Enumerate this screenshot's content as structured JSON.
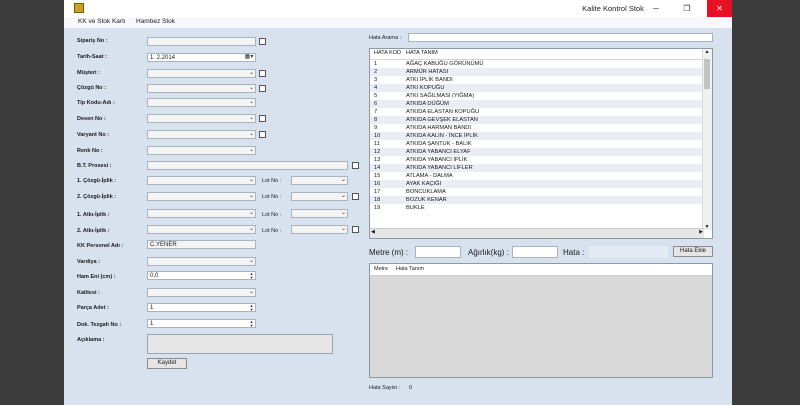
{
  "window": {
    "title": "Kalite Kontrol Stok",
    "minimize": "─",
    "maximize": "❐",
    "close": "✕"
  },
  "menu": [
    "KK ve Stok Kartı",
    "Hambez Stok"
  ],
  "form": {
    "siparis_no": {
      "label": "Sipariş No :",
      "value": ""
    },
    "tarih_saat": {
      "label": "Tarih-Saat :",
      "value": "1.  2.2014"
    },
    "musteri": {
      "label": "Müşteri :"
    },
    "cozgu": {
      "label": "Çözgü No :"
    },
    "tip_kodu": {
      "label": "Tip Kodu-Adı :"
    },
    "desen": {
      "label": "Desen No :"
    },
    "varyant": {
      "label": "Varyant No :"
    },
    "renk": {
      "label": "Renk No :"
    },
    "bt_prosesi": {
      "label": "B.T. Prosesi :"
    },
    "cozgu_iplik_1": {
      "label": "1. Çözgü-İplik :"
    },
    "cozgu_iplik_2": {
      "label": "2. Çözgü-İplik :"
    },
    "atki_iplik_1": {
      "label": "1. Atkı-İplik :"
    },
    "atki_iplik_2": {
      "label": "2. Atkı-İplik :"
    },
    "lot_no_label": "Lot No :",
    "kk_personel": {
      "label": "KK Personel Adı :",
      "value": "C.YENER"
    },
    "vardiya": {
      "label": "Vardiya :"
    },
    "ham_eni": {
      "label": "Ham Eni (cm) :",
      "value": "0,0"
    },
    "kalitesi": {
      "label": "Kalitesi :"
    },
    "parca_adet": {
      "label": "Parça Adet :",
      "value": "1"
    },
    "dok_tezgah": {
      "label": "Dok. Tezgah No :",
      "value": "1"
    },
    "aciklama": {
      "label": "Açıklama :"
    },
    "kaydet": "Kaydet"
  },
  "hata_arama": {
    "label": "Hata Arama :",
    "value": ""
  },
  "hata_table": {
    "columns": [
      "HATA KOD",
      "HATA TANIM"
    ],
    "rows": [
      [
        "1",
        "AĞAÇ KABUĞU GÖRÜNÜMÜ"
      ],
      [
        "2",
        "ARMÜR HATASI"
      ],
      [
        "3",
        "ATKI İPLİK BANDI"
      ],
      [
        "4",
        "ATKI KOPUĞU"
      ],
      [
        "5",
        "ATKI SAĞILMASI (YIĞMA)"
      ],
      [
        "6",
        "ATKIDA DÜĞÜM"
      ],
      [
        "7",
        "ATKIDA ELASTAN KOPUĞU"
      ],
      [
        "8",
        "ATKIDA GEVŞEK ELASTAN"
      ],
      [
        "9",
        "ATKIDA HARMAN BANDI"
      ],
      [
        "10",
        "ATKIDA KALIN - İNCE İPLİK"
      ],
      [
        "11",
        "ATKIDA ŞANTUK - BALIK"
      ],
      [
        "12",
        "ATKIDA YABANCI ELYAF"
      ],
      [
        "13",
        "ATKIDA YABANCI İPLİK"
      ],
      [
        "14",
        "ATKIDA YABANCI LİFLER"
      ],
      [
        "15",
        "ATLAMA - DALMA"
      ],
      [
        "16",
        "AYAK KAÇIĞI"
      ],
      [
        "17",
        "BONCUKLAMA"
      ],
      [
        "18",
        "BOZUK KENAR"
      ],
      [
        "19",
        "BUKLE"
      ]
    ]
  },
  "entry": {
    "metre": "Metre (m) :",
    "agirlik": "Ağırlık(kg) :",
    "hata": "Hata :",
    "hata_ekle": "Hata Ekle"
  },
  "list2": {
    "columns": [
      "Metre",
      "Hata Tanım"
    ]
  },
  "footer": {
    "label": "Hata Sayisi :",
    "value": "0"
  }
}
